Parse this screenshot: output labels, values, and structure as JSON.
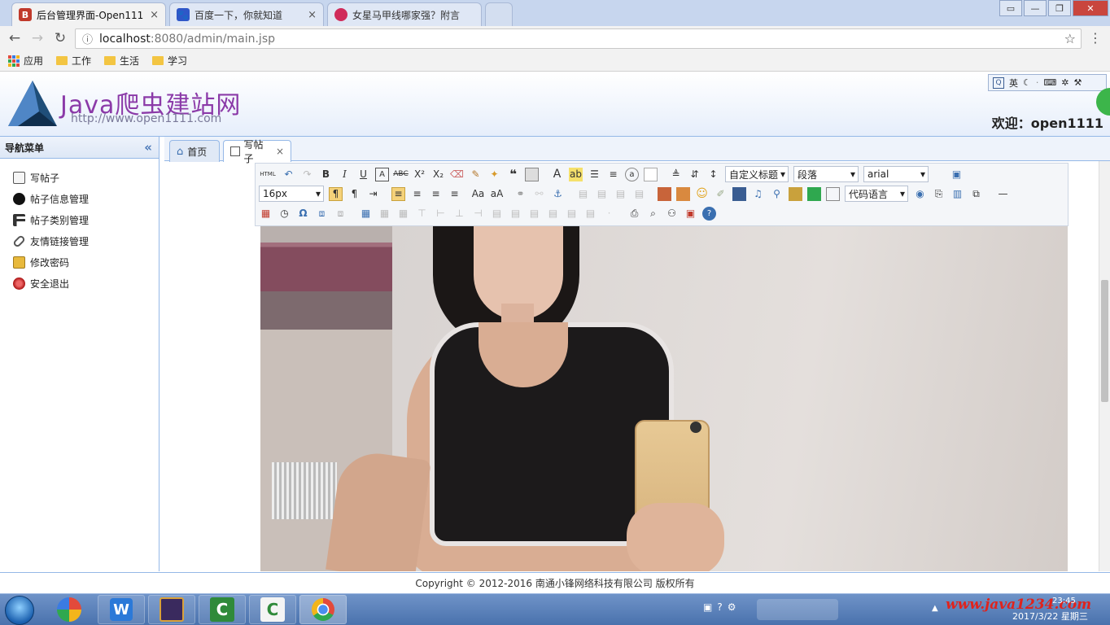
{
  "browser": {
    "tabs": [
      {
        "title": "后台管理界面-Open111",
        "icon_letter": "B",
        "icon_color": "#c0392b",
        "active": true
      },
      {
        "title": "百度一下，你就知道",
        "icon_letter": "",
        "icon_color": "#2f57c8",
        "active": false
      },
      {
        "title": "女星马甲线哪家强？附言",
        "icon_letter": "",
        "icon_color": "#d02b5a",
        "active": false
      }
    ],
    "close_glyph": "×",
    "url_host": "localhost",
    "url_rest": ":8080/admin/main.jsp",
    "bookmarks": [
      "应用",
      "工作",
      "生活",
      "学习"
    ]
  },
  "header": {
    "logo_title": "Java爬虫建站网",
    "logo_url": "http://www.open1111.com",
    "welcome": "欢迎：open1111",
    "ime_label": "英"
  },
  "sidebar": {
    "title": "导航菜单",
    "collapse_glyph": "«",
    "items": [
      {
        "label": "写帖子",
        "icon": "write-post-icon"
      },
      {
        "label": "帖子信息管理",
        "icon": "post-manage-icon"
      },
      {
        "label": "帖子类别管理",
        "icon": "category-icon"
      },
      {
        "label": "友情链接管理",
        "icon": "link-icon"
      },
      {
        "label": "修改密码",
        "icon": "password-icon"
      },
      {
        "label": "安全退出",
        "icon": "logout-icon"
      }
    ]
  },
  "page_tabs": [
    {
      "label": "首页",
      "icon": "home-icon"
    },
    {
      "label": "写帖子",
      "icon": "write-post-icon",
      "closable": true
    }
  ],
  "editor": {
    "html_label": "HTML",
    "heading_select": "自定义标题",
    "paragraph_select": "段落",
    "font_select": "arial",
    "size_select": "16px",
    "code_select": "代码语言"
  },
  "footer": {
    "copyright": "Copyright © 2012-2016 南通小锋网络科技有限公司 版权所有"
  },
  "taskbar": {
    "watermark": "www.java1234.com",
    "date": "2017/3/22 星期三",
    "time": "23:45",
    "apps": [
      "windows-start",
      "app-launcher",
      "wps-writer",
      "java-ee-ide",
      "camtasia-recorder",
      "camtasia-studio",
      "chrome"
    ]
  }
}
